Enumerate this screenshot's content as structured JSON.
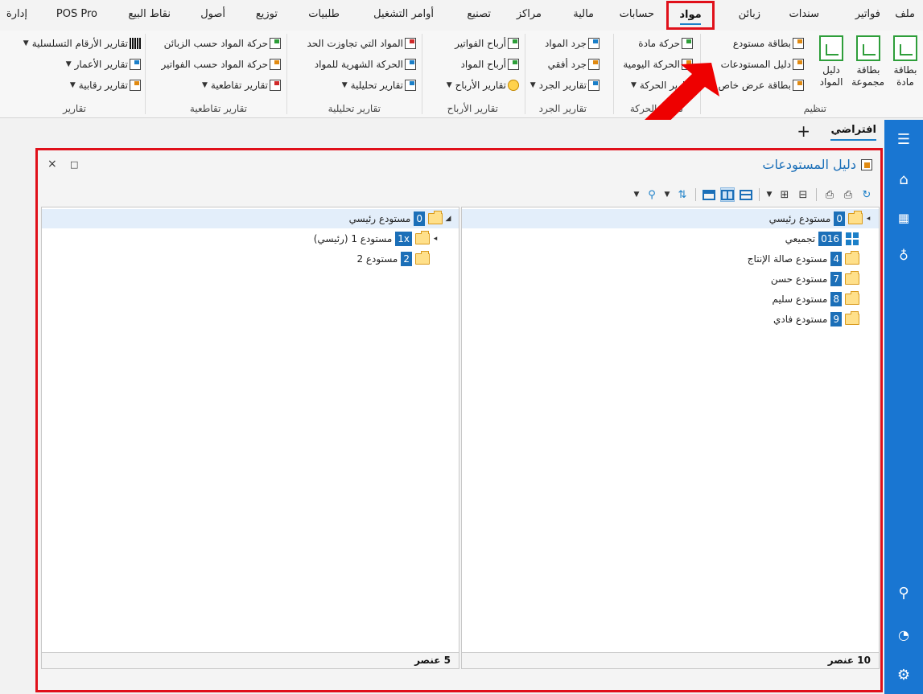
{
  "menu": {
    "items": [
      "ملف",
      "فواتير",
      "سندات",
      "زبائن",
      "مواد",
      "حسابات",
      "مالية",
      "مراكز",
      "تصنيع",
      "أوامر التشغيل",
      "طلبيات",
      "توزيع",
      "أصول",
      "نقاط البيع",
      "POS Pro",
      "إدارة"
    ],
    "active": "مواد"
  },
  "ribbon": {
    "big_buttons": [
      "بطاقة مادة",
      "بطاقة مجموعة",
      "دليل المواد"
    ],
    "tanzim": [
      "بطاقة مستودع",
      "دليل المستودعات",
      "بطاقة عرض خاص"
    ],
    "haraka": [
      "حركة مادة",
      "الحركة اليومية",
      "تقارير الحركة"
    ],
    "jard": [
      "جرد المواد",
      "جرد أفقي",
      "تقارير الجرد"
    ],
    "arbah": [
      "أرباح الفواتير",
      "أرباح المواد",
      "تقارير الأرباح"
    ],
    "tahliliya": [
      "المواد التي تجاوزت الحد",
      "الحركة الشهرية للمواد",
      "تقارير تحليلية"
    ],
    "taqatuiya": [
      "حركة المواد حسب الزبائن",
      "حركة المواد حسب الفواتير",
      "تقارير تقاطعية"
    ],
    "taqarir": [
      "تقارير الأرقام التسلسلية",
      "تقارير الأعمار",
      "تقارير رقابية"
    ],
    "group_labels": {
      "tanzim": "تنظيم",
      "haraka": "تقارير الحركة",
      "jard": "تقارير الجرد",
      "arbah": "تقارير الأرباح",
      "tahliliya": "تقارير تحليلية",
      "taqatuiya": "تقارير تقاطعية",
      "taqarir": "تقارير"
    }
  },
  "tabs": {
    "default": "افتراضي",
    "add": "+"
  },
  "window": {
    "title": "دليل المستودعات",
    "close": "×",
    "maximize": "□"
  },
  "right_tree": {
    "nodes": [
      {
        "code": "0",
        "name": "مستودع رئيسي",
        "icon": "folder"
      },
      {
        "code": "016",
        "name": "تجميعي",
        "icon": "grid"
      },
      {
        "code": "4",
        "name": "مستودع صالة الإنتاج",
        "icon": "folder"
      },
      {
        "code": "7",
        "name": "مستودع حسن",
        "icon": "folder"
      },
      {
        "code": "8",
        "name": "مستودع سليم",
        "icon": "folder"
      },
      {
        "code": "9",
        "name": "مستودع فادي",
        "icon": "folder"
      }
    ],
    "footer": "10 عنصر"
  },
  "left_tree": {
    "nodes": [
      {
        "code": "0",
        "name": "مستودع رئيسي"
      },
      {
        "code": "1x",
        "name": "مستودع 1 (رئيسي)"
      },
      {
        "code": "2",
        "name": "مستودع 2"
      }
    ],
    "footer": "5 عنصر"
  },
  "colors": {
    "accent": "#1976d2",
    "highlight": "#e0101a",
    "folder": "#ffe08a"
  }
}
